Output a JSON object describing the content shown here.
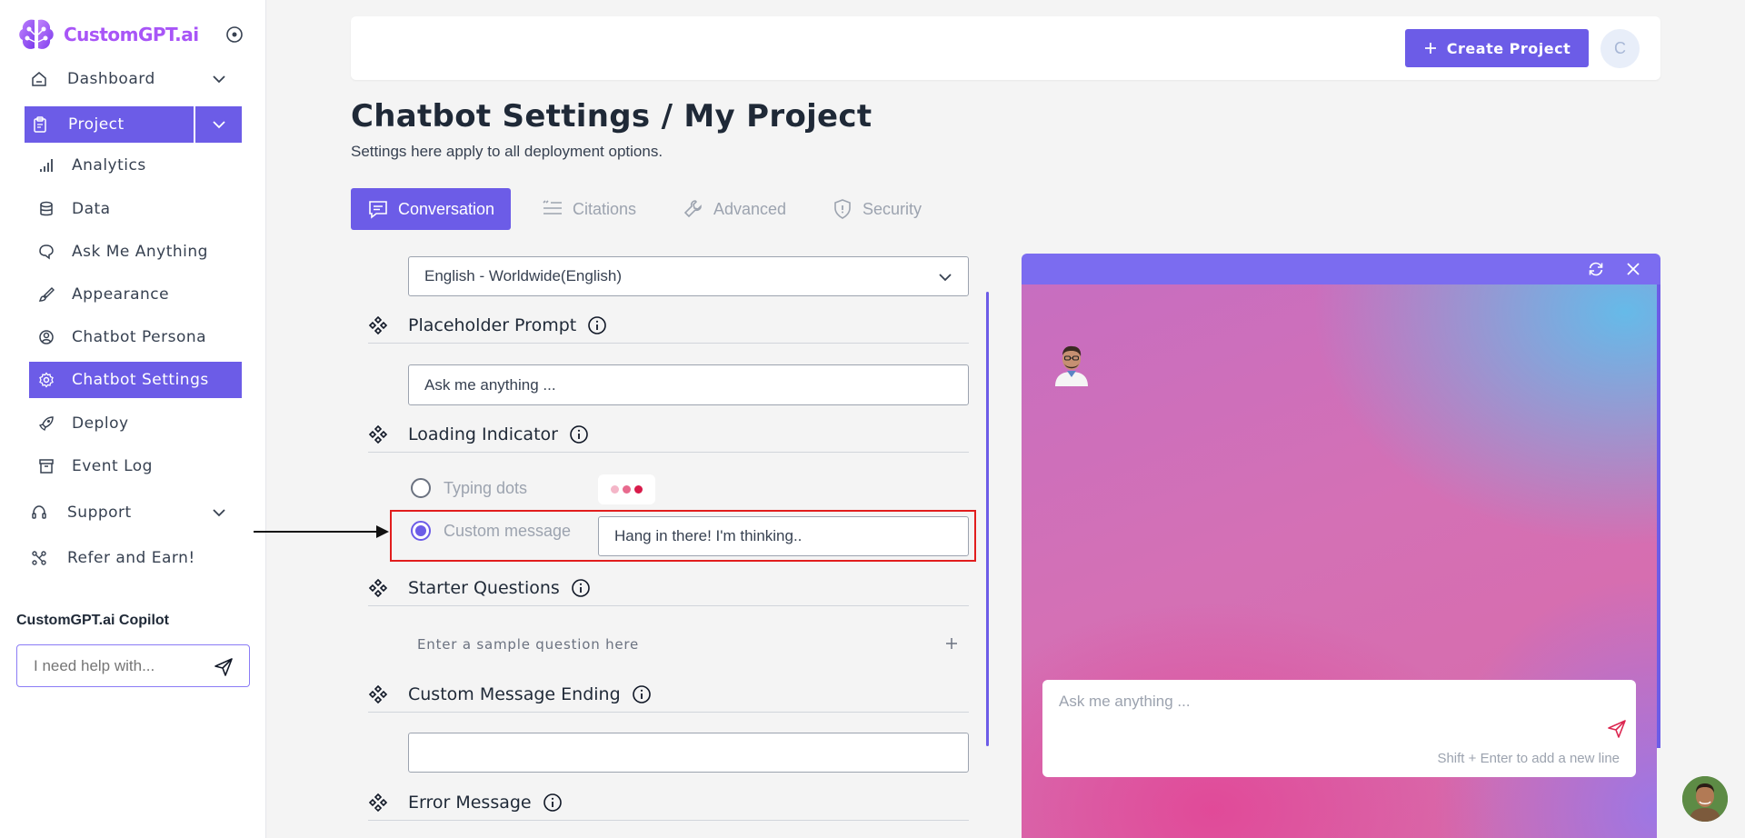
{
  "brand": {
    "name": "CustomGPT.ai"
  },
  "sidebar": {
    "items": [
      {
        "label": "Dashboard"
      },
      {
        "label": "Project"
      },
      {
        "label": "Analytics"
      },
      {
        "label": "Data"
      },
      {
        "label": "Ask Me Anything"
      },
      {
        "label": "Appearance"
      },
      {
        "label": "Chatbot Persona"
      },
      {
        "label": "Chatbot Settings"
      },
      {
        "label": "Deploy"
      },
      {
        "label": "Event Log"
      },
      {
        "label": "Support"
      },
      {
        "label": "Refer and Earn!"
      }
    ],
    "copilot": {
      "title": "CustomGPT.ai Copilot",
      "placeholder": "I need help with..."
    }
  },
  "header": {
    "create_label": "Create Project",
    "avatar_initial": "C"
  },
  "page": {
    "title": "Chatbot Settings / My Project",
    "subtitle": "Settings here apply to all deployment options."
  },
  "tabs": [
    {
      "label": "Conversation",
      "active": true
    },
    {
      "label": "Citations",
      "active": false
    },
    {
      "label": "Advanced",
      "active": false
    },
    {
      "label": "Security",
      "active": false
    }
  ],
  "settings": {
    "language_value": "English - Worldwide(English)",
    "placeholder_prompt": {
      "title": "Placeholder Prompt",
      "value": "Ask me anything ..."
    },
    "loading_indicator": {
      "title": "Loading Indicator",
      "option_dots": "Typing dots",
      "option_custom": "Custom message",
      "selected": "Custom message",
      "custom_value": "Hang in there! I'm thinking.."
    },
    "starter_questions": {
      "title": "Starter Questions",
      "placeholder": "Enter a sample question here"
    },
    "custom_message_ending": {
      "title": "Custom Message Ending",
      "value": ""
    },
    "error_message": {
      "title": "Error Message"
    }
  },
  "chat_preview": {
    "input_placeholder": "Ask me anything ...",
    "hint": "Shift + Enter to add a new line"
  },
  "colors": {
    "accent": "#6c5ce7",
    "highlight": "#e11d1d",
    "typing_dots": [
      "#f4b6c8",
      "#e86a8e",
      "#d81b4a"
    ]
  }
}
